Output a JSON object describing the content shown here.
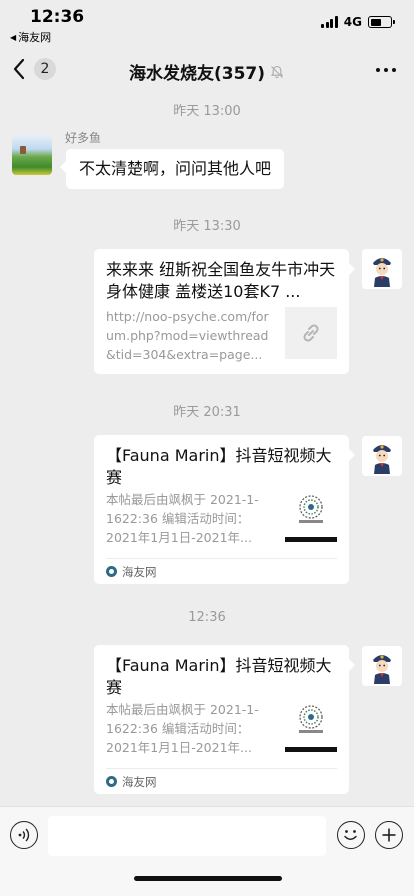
{
  "status_bar": {
    "time": "12:36",
    "back_app": "海友网",
    "network": "4G",
    "battery_level": 0.55
  },
  "nav": {
    "unread_count": "2",
    "title": "海水发烧友(357)",
    "muted_icon": "bell-slash-icon",
    "more_icon": "more-dots-icon"
  },
  "messages": [
    {
      "type": "time",
      "text": "昨天 13:00"
    },
    {
      "type": "text",
      "side": "left",
      "sender": "好多鱼",
      "text": "不太清楚啊，问问其他人吧"
    },
    {
      "type": "time",
      "text": "昨天 13:30"
    },
    {
      "type": "link",
      "side": "right",
      "title": "来来来 纽斯祝全国鱼友牛市冲天 身体健康 盖楼送10套K7 ...",
      "desc": "http://noo-psyche.com/forum.php?mod=viewthread&tid=304&extra=page..."
    },
    {
      "type": "time",
      "text": "昨天 20:31"
    },
    {
      "type": "link",
      "side": "right",
      "title": "【Fauna Marin】抖音短视频大赛",
      "desc": "本帖最后由飒枫于 2021-1-1622:36 编辑活动时间：2021年1月1日-2021年...",
      "source": "海友网"
    },
    {
      "type": "time",
      "text": "12:36"
    },
    {
      "type": "link",
      "side": "right",
      "title": "【Fauna Marin】抖音短视频大赛",
      "desc": "本帖最后由飒枫于 2021-1-1622:36 编辑活动时间：2021年1月1日-2021年...",
      "source": "海友网"
    }
  ],
  "input_bar": {
    "placeholder": ""
  }
}
